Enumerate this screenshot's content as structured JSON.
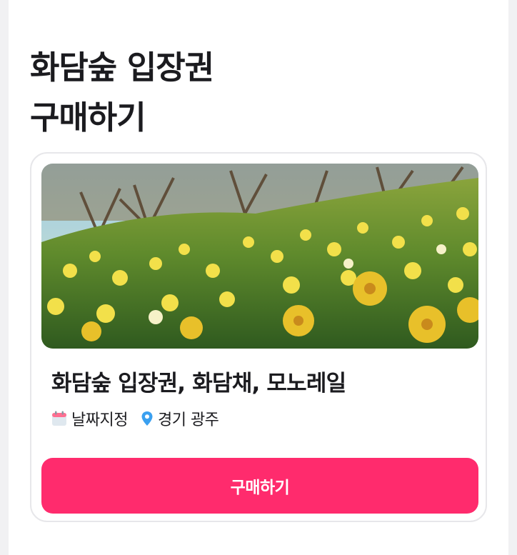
{
  "page": {
    "heading_line1": "화담숲 입장권",
    "heading_line2": "구매하기"
  },
  "card": {
    "image_icon": "daffodil-field-photo",
    "title": "화담숲 입장권, 화담채, 모노레일",
    "date_icon": "calendar-icon",
    "date_label": "날짜지정",
    "location_icon": "location-pin-icon",
    "location_label": "경기 광주",
    "buy_label": "구매하기"
  },
  "colors": {
    "accent": "#ff2b6d",
    "pin": "#3aa0f0",
    "calendar": "#ff6f91"
  }
}
